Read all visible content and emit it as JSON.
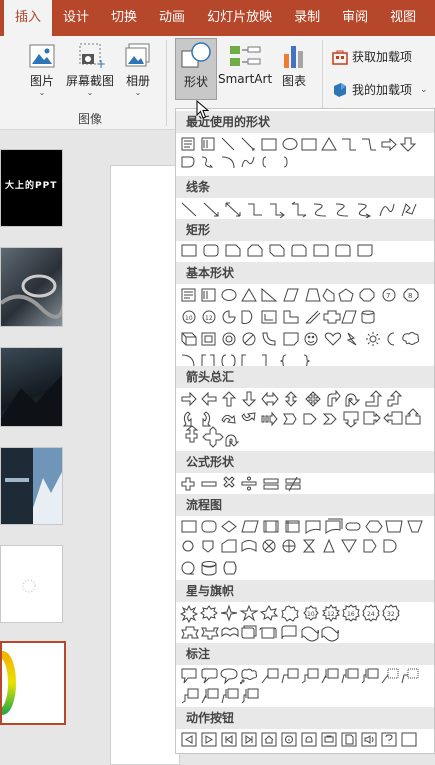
{
  "tabs": [
    "插入",
    "设计",
    "切换",
    "动画",
    "幻灯片放映",
    "录制",
    "审阅",
    "视图"
  ],
  "ribbon": {
    "pictures": "图片",
    "screenshot": "屏幕截图",
    "album": "相册",
    "images_group": "图像",
    "shapes": "形状",
    "smartart": "SmartArt",
    "chart": "图表",
    "get_addins": "获取加载项",
    "my_addins": "我的加载项"
  },
  "thumb1_text": "大上的PPT",
  "sections": {
    "recent": "最近使用的形状",
    "lines": "线条",
    "rects": "矩形",
    "basic": "基本形状",
    "arrows": "箭头总汇",
    "equation": "公式形状",
    "flowchart": "流程图",
    "stars": "星与旗帜",
    "callouts": "标注",
    "actions": "动作按钮"
  },
  "colors": {
    "accent": "#b7472a",
    "panel": "#ffffff",
    "header": "#e8e8e8"
  }
}
